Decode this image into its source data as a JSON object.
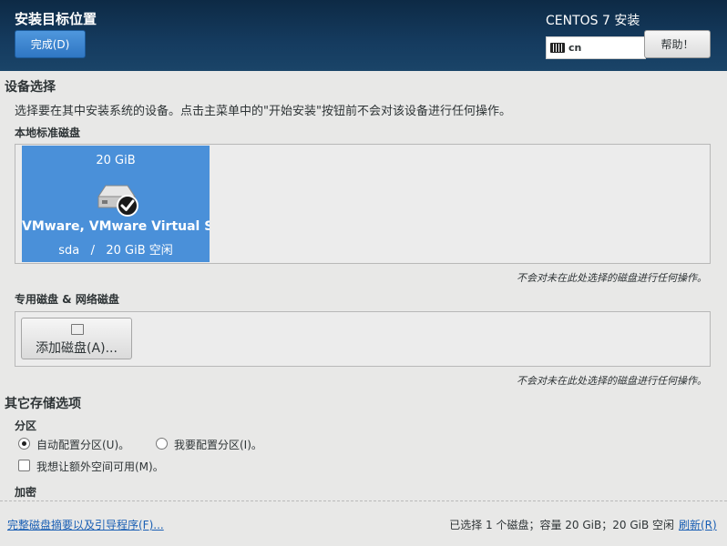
{
  "header": {
    "title": "安装目标位置",
    "done_label": "完成(D)",
    "product": "CENTOS 7 安装",
    "keyboard_layout": "cn",
    "help_label": "帮助！"
  },
  "device_selection": {
    "heading": "设备选择",
    "description": "选择要在其中安装系统的设备。点击主菜单中的\"开始安装\"按钮前不会对该设备进行任何操作。",
    "local_disks_label": "本地标准磁盘",
    "disk": {
      "size": "20 GiB",
      "name": "VMware, VMware Virtual S",
      "info": "sda   /   20 GiB 空闲",
      "selected": true
    },
    "local_note": "不会对未在此处选择的磁盘进行任何操作。",
    "special_disks_label": "专用磁盘 & 网络磁盘",
    "add_disk_label": "添加磁盘(A)...",
    "special_note": "不会对未在此处选择的磁盘进行任何操作。"
  },
  "other_storage": {
    "heading": "其它存储选项",
    "partition_label": "分区",
    "auto_partition": "自动配置分区(U)。",
    "manual_partition": "我要配置分区(I)。",
    "extra_space": "我想让额外空间可用(M)。",
    "encryption_label": "加密"
  },
  "footer": {
    "summary_link": "完整磁盘摘要以及引导程序(F)...",
    "status": "已选择 1 个磁盘；容量 20 GiB；20 GiB 空闲",
    "refresh": "刷新(R)"
  },
  "colors": {
    "header_bg": "#153b5f",
    "accent": "#4a90d9",
    "link": "#1a5fb4"
  }
}
